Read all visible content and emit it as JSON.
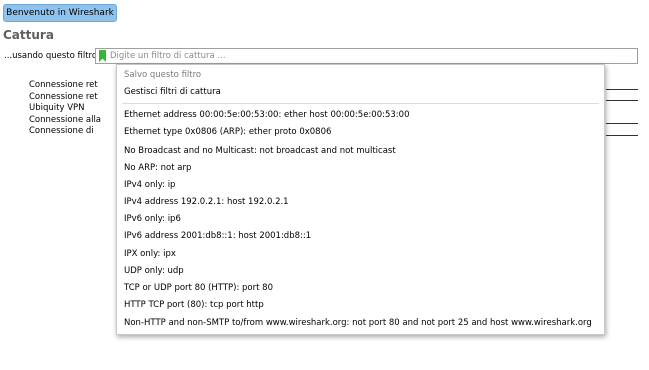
{
  "welcome_button": "Benvenuto in Wireshark",
  "capture": {
    "title": "Cattura",
    "filter_label": "...usando questo filtro:",
    "filter_placeholder": "Digite un filtro di cattura ..."
  },
  "interfaces": [
    "Connessione ret",
    "Connessione ret",
    "Ubiquity VPN",
    "Connessione alla",
    "Connessione di"
  ],
  "dropdown": {
    "save_filter": "Salvo questo filtro",
    "manage_filters": "Gestisci filtri di cattura",
    "filters": [
      "Ethernet address 00:00:5e:00:53:00: ether host 00:00:5e:00:53:00",
      "Ethernet type 0x0806 (ARP): ether proto 0x0806",
      "No Broadcast and no Multicast: not broadcast and not multicast",
      "No ARP: not arp",
      "IPv4 only: ip",
      "IPv4 address 192.0.2.1: host 192.0.2.1",
      "IPv6 only: ip6",
      "IPv6 address 2001:db8::1: host 2001:db8::1",
      "IPX only: ipx",
      "UDP only: udp",
      "TCP or UDP port 80 (HTTP): port 80",
      "HTTP TCP port (80): tcp port http",
      "Non-HTTP and non-SMTP to/from www.wireshark.org: not port 80 and not port 25 and host www.wireshark.org"
    ]
  }
}
